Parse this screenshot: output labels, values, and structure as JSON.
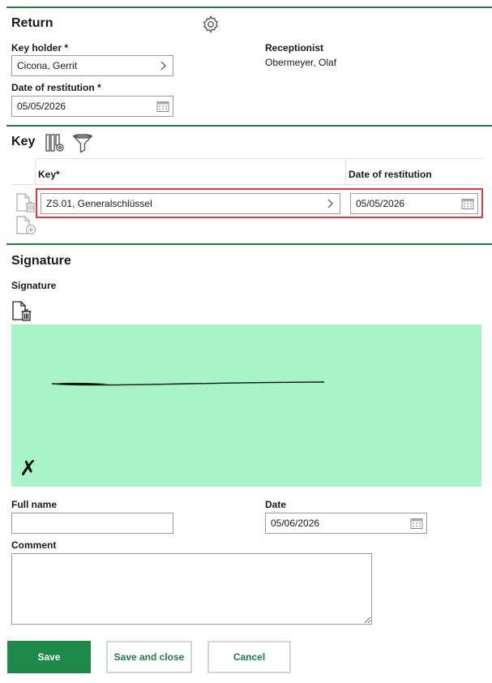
{
  "return_section": {
    "title": "Return",
    "key_holder_label": "Key holder *",
    "key_holder_value": "Cicona, Gerrit",
    "receptionist_label": "Receptionist",
    "receptionist_value": "Obermeyer, Olaf",
    "date_label": "Date of restitution *",
    "date_value": "05/05/2026"
  },
  "key_section": {
    "title": "Key",
    "col_key": "Key*",
    "col_date": "Date of restitution",
    "rows": [
      {
        "key": "ZS.01, Generalschlüssel",
        "date": "05/05/2026"
      }
    ]
  },
  "signature_section": {
    "title": "Signature",
    "signature_label": "Signature",
    "pad_color": "#a8f2c8",
    "sign_mark": "✗",
    "full_name_label": "Full name",
    "full_name_value": "",
    "date_label": "Date",
    "date_value": "05/06/2026",
    "comment_label": "Comment",
    "comment_value": ""
  },
  "buttons": {
    "save": "Save",
    "save_close": "Save and close",
    "cancel": "Cancel"
  },
  "colors": {
    "accent": "#1e7e45",
    "highlight": "#e0393e"
  }
}
